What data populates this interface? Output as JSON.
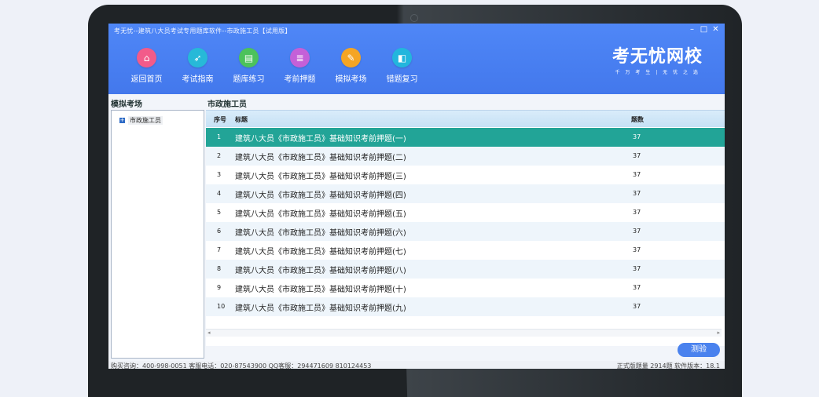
{
  "window": {
    "title": "考无忧--建筑八大员考试专用题库软件--市政施工员【试用版】",
    "controls": [
      "–",
      "□",
      "✕"
    ]
  },
  "nav": [
    {
      "label": "返回首页",
      "icon": "home-icon",
      "color": "#f25b8a",
      "glyph": "⌂"
    },
    {
      "label": "考试指南",
      "icon": "compass-icon",
      "color": "#27b9d8",
      "glyph": "➶"
    },
    {
      "label": "题库练习",
      "icon": "question-bank-icon",
      "color": "#4cc25b",
      "glyph": "▤"
    },
    {
      "label": "考前押题",
      "icon": "notes-icon",
      "color": "#c460d8",
      "glyph": "≣"
    },
    {
      "label": "模拟考场",
      "icon": "pencil-icon",
      "color": "#f5a524",
      "glyph": "✎"
    },
    {
      "label": "错题复习",
      "icon": "review-icon",
      "color": "#23b6dd",
      "glyph": "◧"
    }
  ],
  "logo": {
    "main": "考无忧网校",
    "sub": "千 万 考 生 | 无 忧 之 选"
  },
  "left_panel": {
    "heading": "模拟考场",
    "tree": [
      {
        "expander": "+",
        "label": "市政施工员"
      }
    ]
  },
  "right_panel": {
    "heading": "市政施工员",
    "columns": {
      "no": "序号",
      "title": "标题",
      "count": "题数"
    },
    "rows": [
      {
        "no": "1",
        "title": "建筑八大员《市政施工员》基础知识考前押题(一)",
        "count": "37"
      },
      {
        "no": "2",
        "title": "建筑八大员《市政施工员》基础知识考前押题(二)",
        "count": "37"
      },
      {
        "no": "3",
        "title": "建筑八大员《市政施工员》基础知识考前押题(三)",
        "count": "37"
      },
      {
        "no": "4",
        "title": "建筑八大员《市政施工员》基础知识考前押题(四)",
        "count": "37"
      },
      {
        "no": "5",
        "title": "建筑八大员《市政施工员》基础知识考前押题(五)",
        "count": "37"
      },
      {
        "no": "6",
        "title": "建筑八大员《市政施工员》基础知识考前押题(六)",
        "count": "37"
      },
      {
        "no": "7",
        "title": "建筑八大员《市政施工员》基础知识考前押题(七)",
        "count": "37"
      },
      {
        "no": "8",
        "title": "建筑八大员《市政施工员》基础知识考前押题(八)",
        "count": "37"
      },
      {
        "no": "9",
        "title": "建筑八大员《市政施工员》基础知识考前押题(十)",
        "count": "37"
      },
      {
        "no": "10",
        "title": "建筑八大员《市政施工员》基础知识考前押题(九)",
        "count": "37"
      }
    ],
    "selected_index": 0,
    "test_button": "测验"
  },
  "status_bar": {
    "left": "购买咨询：400-998-0051  客服电话：020-87543900  QQ客服：294471609  810124453",
    "right": "正式版题量 2914题   软件版本：18.1"
  },
  "colors": {
    "header": "#4a80f2",
    "selected_row": "#22a497",
    "button": "#4a82ee"
  }
}
